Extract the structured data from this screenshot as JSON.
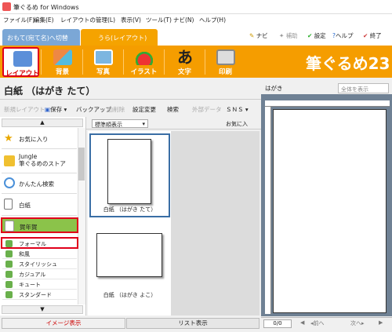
{
  "window": {
    "title": "筆ぐるめ for Windows"
  },
  "menu": [
    "ファイル(F)",
    "編集(E)",
    "レイアウトの管理(L)",
    "表示(V)",
    "ツール(T)",
    "ナビ(N)",
    "ヘルプ(H)"
  ],
  "tabs": {
    "front": "おもて(宛て名)へ切替",
    "back": "うら(レイアウト)"
  },
  "topnav": {
    "navi": "ナビ",
    "assist": "補助",
    "settings": "設定",
    "help": "ヘルプ",
    "exit": "終了"
  },
  "toolbar": {
    "items": [
      "レイアウト",
      "背景",
      "写真",
      "イラスト",
      "文字",
      "印刷"
    ],
    "brand": "筆ぐるめ23"
  },
  "header": {
    "title": "白紙 （はがき たて）",
    "preview_label": "はがき",
    "zoom": "全体を表示"
  },
  "actions": [
    "新規レイアウト",
    "保存",
    "バックアップ",
    "削除",
    "設定変更",
    "検索",
    "外部データ",
    "ＳＮＳ"
  ],
  "sidebar": {
    "items": [
      "お気に入り",
      "Jungle\n筆ぐるめのストア",
      "かんたん検索",
      "白紙",
      "賀年賀"
    ],
    "subitems": [
      "フォーマル",
      "和風",
      "スタイリッシュ",
      "カジュアル",
      "キュート",
      "スタンダード"
    ]
  },
  "templates": {
    "sort": "標準順表示",
    "favorite": "お気に入",
    "cards": [
      "白紙 （はがき たて）",
      "白紙 （はがき よこ）"
    ]
  },
  "bottom": {
    "image_view": "イメージ表示",
    "list_view": "リスト表示"
  },
  "pager": {
    "count": "0/0",
    "prev": "前へ",
    "next": "次へ"
  },
  "colors": {
    "orange": "#f59d00",
    "selected_border": "#e0001b",
    "tab_blue": "#7ba7d6"
  }
}
